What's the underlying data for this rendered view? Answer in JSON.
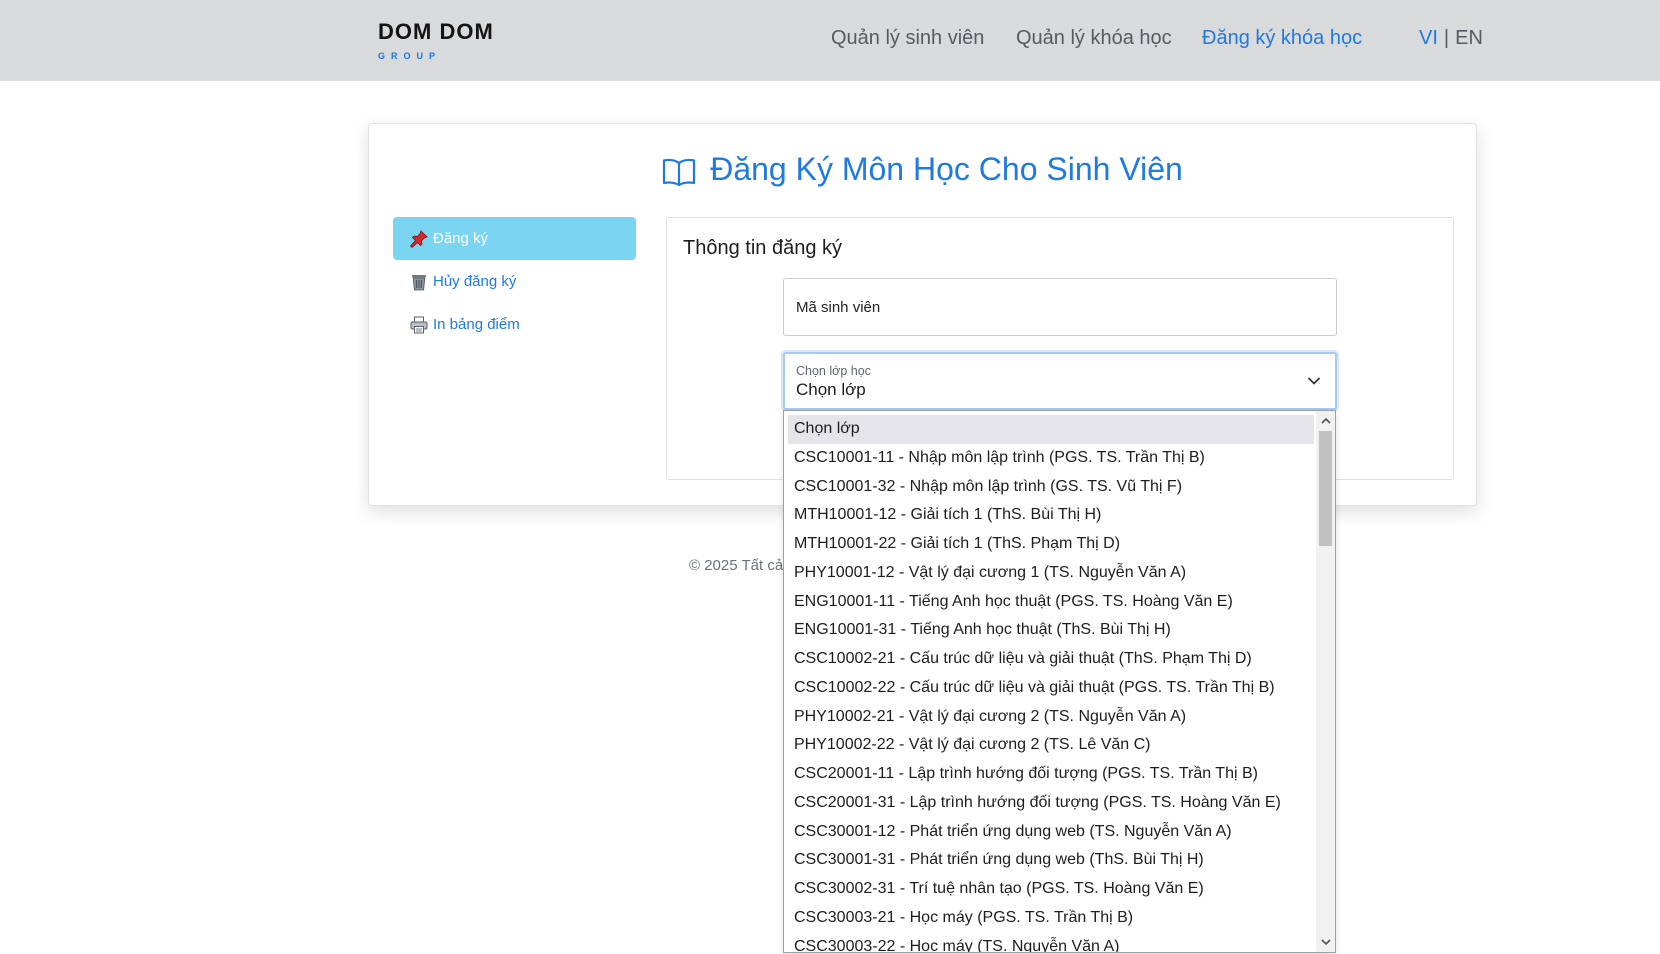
{
  "brand": {
    "name": "DOM DOM",
    "sub": "GROUP"
  },
  "nav": {
    "items": [
      {
        "label": "Quản lý sinh viên"
      },
      {
        "label": "Quản lý khóa học"
      },
      {
        "label": "Đăng ký khóa học",
        "active": true
      }
    ],
    "lang": {
      "vi": "VI",
      "sep": "|",
      "en": "EN"
    }
  },
  "page": {
    "title": "Đăng Ký Môn Học Cho Sinh Viên"
  },
  "sidebar": {
    "items": [
      {
        "label": "Đăng ký",
        "icon": "pushpin-icon",
        "active": true
      },
      {
        "label": "Hủy đăng ký",
        "icon": "trash-icon"
      },
      {
        "label": "In bảng điểm",
        "icon": "printer-icon"
      }
    ]
  },
  "form": {
    "title": "Thông tin đăng ký",
    "student_id": {
      "placeholder": "Mã sinh viên",
      "value": ""
    },
    "class_select": {
      "label": "Chọn lớp học",
      "value": "Chọn lớp",
      "options": [
        "Chọn lớp",
        "CSC10001-11 - Nhập môn lập trình (PGS. TS. Trần Thị B)",
        "CSC10001-32 - Nhập môn lập trình (GS. TS. Vũ Thị F)",
        "MTH10001-12 - Giải tích 1 (ThS. Bùi Thị H)",
        "MTH10001-22 - Giải tích 1 (ThS. Phạm Thị D)",
        "PHY10001-12 - Vật lý đại cương 1 (TS. Nguyễn Văn A)",
        "ENG10001-11 - Tiếng Anh học thuật (PGS. TS. Hoàng Văn E)",
        "ENG10001-31 - Tiếng Anh học thuật (ThS. Bùi Thị H)",
        "CSC10002-21 - Cấu trúc dữ liệu và giải thuật (ThS. Phạm Thị D)",
        "CSC10002-22 - Cấu trúc dữ liệu và giải thuật (PGS. TS. Trần Thị B)",
        "PHY10002-21 - Vật lý đại cương 2 (TS. Nguyễn Văn A)",
        "PHY10002-22 - Vật lý đại cương 2 (TS. Lê Văn C)",
        "CSC20001-11 - Lập trình hướng đối tượng (PGS. TS. Trần Thị B)",
        "CSC20001-31 - Lập trình hướng đối tượng (PGS. TS. Hoàng Văn E)",
        "CSC30001-12 - Phát triển ứng dụng web (TS. Nguyễn Văn A)",
        "CSC30001-31 - Phát triển ứng dụng web (ThS. Bùi Thị H)",
        "CSC30002-31 - Trí tuệ nhân tạo (PGS. TS. Hoàng Văn E)",
        "CSC30003-21 - Học máy (PGS. TS. Trần Thị B)",
        "CSC30003-22 - Học máy (TS. Nguyễn Văn A)"
      ]
    }
  },
  "footer": {
    "text": "© 2025 Tất cả"
  },
  "colors": {
    "accent": "#1f7ae0",
    "navbar": "#d9dadc",
    "active_tab": "#79d5f1"
  }
}
